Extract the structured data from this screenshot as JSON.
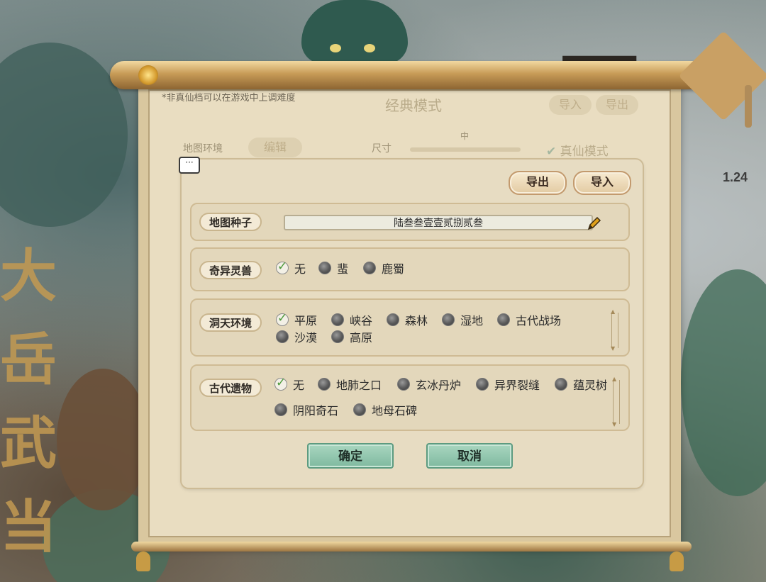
{
  "version": "1.24",
  "background_note": "*非真仙档可以在游戏中上调难度",
  "background_panel": {
    "mode_title": "经典模式",
    "import_label": "导入",
    "export_label": "导出",
    "map_env_label": "地图环境",
    "edit_label": "编辑",
    "size_label": "尺寸",
    "size_value": "中",
    "true_immortal_label": "真仙模式"
  },
  "background_calligraphy": "大岳武当",
  "dialog": {
    "export_label": "导出",
    "import_label": "导入",
    "seed": {
      "label": "地图种子",
      "value": "陆叁叁壹壹贰捌贰叁"
    },
    "beast": {
      "label": "奇异灵兽",
      "options": [
        {
          "label": "无",
          "checked": true
        },
        {
          "label": "蜚",
          "checked": false
        },
        {
          "label": "鹿蜀",
          "checked": false
        }
      ]
    },
    "cave": {
      "label": "洞天环境",
      "options": [
        {
          "label": "平原",
          "checked": true
        },
        {
          "label": "峡谷",
          "checked": false
        },
        {
          "label": "森林",
          "checked": false
        },
        {
          "label": "湿地",
          "checked": false
        },
        {
          "label": "古代战场",
          "checked": false
        },
        {
          "label": "沙漠",
          "checked": false
        },
        {
          "label": "高原",
          "checked": false
        }
      ]
    },
    "relic": {
      "label": "古代遗物",
      "options": [
        {
          "label": "无",
          "checked": true
        },
        {
          "label": "地肺之口",
          "checked": false
        },
        {
          "label": "玄冰丹炉",
          "checked": false
        },
        {
          "label": "异界裂缝",
          "checked": false
        },
        {
          "label": "蕴灵树",
          "checked": false
        },
        {
          "label": "阴阳奇石",
          "checked": false
        },
        {
          "label": "地母石碑",
          "checked": false
        }
      ]
    },
    "confirm_label": "确定",
    "cancel_label": "取消"
  },
  "colors": {
    "paper": "#e9ddc1",
    "accent_gold": "#c79b57",
    "button_green": "#8fc6ac",
    "check_green": "#4c9a3a"
  }
}
